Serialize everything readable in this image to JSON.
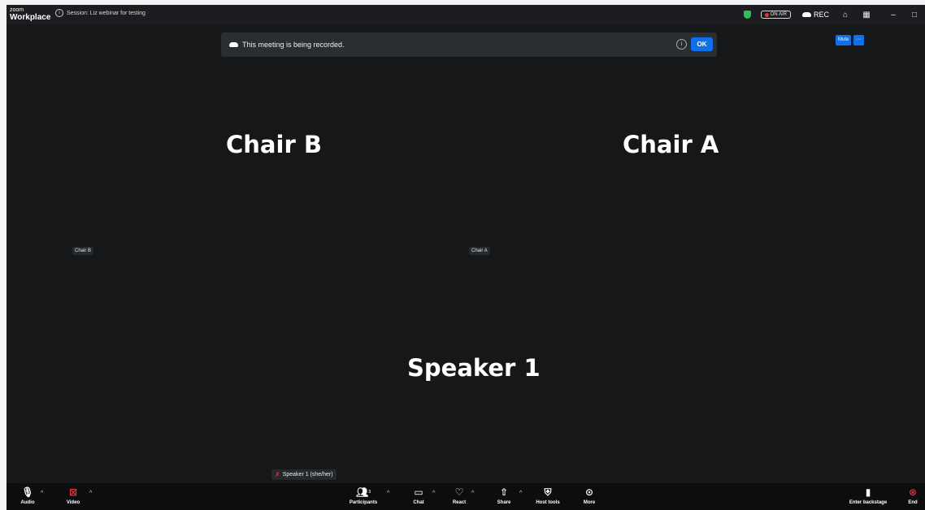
{
  "titlebar": {
    "logo_small": "zoom",
    "logo_big": "Workplace",
    "session_title": "Session: Liz webinar for testing",
    "onair_label": "ON AIR",
    "rec_label": "REC",
    "minimize": "–",
    "maximize": "□"
  },
  "banner": {
    "message": "This meeting is being recorded.",
    "info_glyph": "i",
    "ok_label": "OK"
  },
  "self_view": {
    "mute_label": "Mute",
    "more_label": "···"
  },
  "participants": [
    {
      "display_name": "Chair B",
      "tag": "Chair B"
    },
    {
      "display_name": "Chair A",
      "tag": "Chair A"
    },
    {
      "display_name": "Speaker 1",
      "tag": "Speaker 1 (she/her)"
    }
  ],
  "toolbar": {
    "audio": "Audio",
    "video": "Video",
    "participants": "Participants",
    "participants_count": "3",
    "chat": "Chat",
    "react": "React",
    "share": "Share",
    "host_tools": "Host tools",
    "more": "More",
    "enter_backstage": "Enter backstage",
    "end": "End"
  },
  "icons": {
    "shield": "shield-icon",
    "cloud": "cloud-icon",
    "mic": "microphone-icon",
    "video_off": "video-off-icon",
    "participants": "participants-icon",
    "chat": "chat-bubble-icon",
    "react": "heart-icon",
    "share": "share-screen-icon",
    "host_tools": "shield-tools-icon",
    "more": "more-dots-icon",
    "backstage": "door-icon",
    "end": "end-icon"
  },
  "colors": {
    "accent_blue": "#0e71eb",
    "recording_red": "#e0333b",
    "security_green": "#2dbd5a",
    "video_bg": "#151719"
  }
}
